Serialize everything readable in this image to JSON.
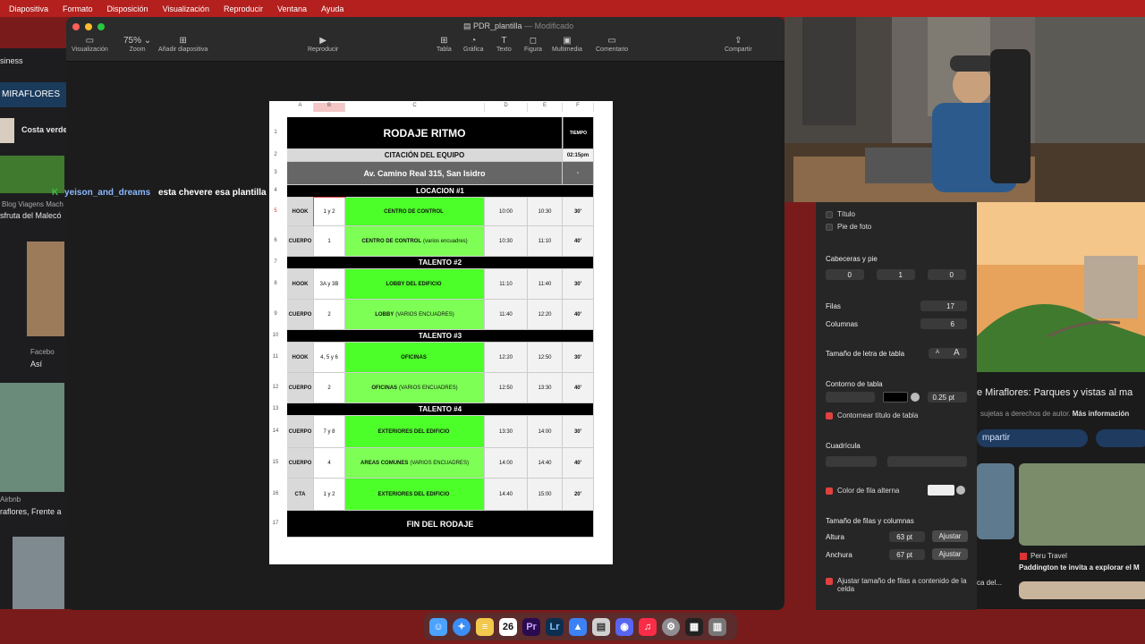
{
  "menubar": {
    "items": [
      "Diapositiva",
      "Formato",
      "Disposición",
      "Visualización",
      "Reproducir",
      "Ventana",
      "Ayuda"
    ]
  },
  "left_browser": {
    "items": [
      "siness",
      "MIRAFLORES",
      "Costa verde",
      "yeison_and_dreams",
      "esta chevere esa plantilla",
      "Blog Viagens Mach",
      "sfruta del Malecó",
      "Facebo",
      "Así",
      "Airbnb",
      "raflores, Frente a"
    ]
  },
  "keynote": {
    "title": "PDR_plantilla",
    "title_sub": "— Modificado",
    "zoom": "75%",
    "toolbar": [
      {
        "label": "Visualización",
        "icon": "sidebar-icon"
      },
      {
        "label": "Zoom",
        "icon": "zoom-icon"
      },
      {
        "label": "Añadir diapositiva",
        "icon": "plus-icon"
      },
      {
        "label": "Reproducir",
        "icon": "play-icon"
      },
      {
        "label": "Tabla",
        "icon": "table-icon"
      },
      {
        "label": "Gráfica",
        "icon": "chart-icon"
      },
      {
        "label": "Texto",
        "icon": "text-icon"
      },
      {
        "label": "Figura",
        "icon": "shape-icon"
      },
      {
        "label": "Multimedia",
        "icon": "media-icon"
      },
      {
        "label": "Comentario",
        "icon": "comment-icon"
      },
      {
        "label": "Compartir",
        "icon": "share-icon"
      }
    ]
  },
  "table": {
    "columns": [
      "A",
      "B",
      "C",
      "D",
      "E",
      "F"
    ],
    "row_numbers": [
      "1",
      "2",
      "3",
      "4",
      "5",
      "6",
      "7",
      "8",
      "9",
      "10",
      "11",
      "12",
      "13",
      "14",
      "15",
      "16",
      "17"
    ],
    "title": "RODAJE RITMO",
    "tiempo": "TIEMPO",
    "citacion": "CITACIÓN DEL EQUIPO",
    "citacion_time": "02:15pm",
    "address": "Av. Camino Real 315, San Isidro",
    "address_right": "-",
    "sections": [
      "LOCACION #1",
      "TALENTO #2",
      "TALENTO #3",
      "TALENTO #4"
    ],
    "rows": [
      {
        "a": "HOOK",
        "b": "1 y 2",
        "c": "CENTRO DE CONTROL",
        "c_sub": "",
        "d": "10:00",
        "e": "10:30",
        "f": "30'"
      },
      {
        "a": "CUERPO",
        "b": "1",
        "c": "CENTRO DE CONTROL",
        "c_sub": "(varios encuadres)",
        "d": "10:30",
        "e": "11:10",
        "f": "40'"
      },
      {
        "a": "HOOK",
        "b": "3A y 3B",
        "c": "LOBBY DEL EDIFICIO",
        "c_sub": "",
        "d": "11:10",
        "e": "11:40",
        "f": "30'"
      },
      {
        "a": "CUERPO",
        "b": "2",
        "c": "LOBBY",
        "c_sub": "(VARIOS ENCUADRES)",
        "d": "11:40",
        "e": "12:20",
        "f": "40'"
      },
      {
        "a": "HOOK",
        "b": "4, 5 y 6",
        "c": "OFICINAS",
        "c_sub": "",
        "d": "12:20",
        "e": "12:50",
        "f": "30'"
      },
      {
        "a": "CUERPO",
        "b": "2",
        "c": "OFICINAS",
        "c_sub": "(VARIOS ENCUADRES)",
        "d": "12:50",
        "e": "13:30",
        "f": "40'"
      },
      {
        "a": "CUERPO",
        "b": "7 y 8",
        "c": "EXTERIORES DEL EDIFICIO",
        "c_sub": "",
        "d": "13:30",
        "e": "14:00",
        "f": "30'"
      },
      {
        "a": "CUERPO",
        "b": "4",
        "c": "AREAS COMUNES",
        "c_sub": "(VARIOS ENCUADRES)",
        "d": "14:00",
        "e": "14:40",
        "f": "40'"
      },
      {
        "a": "CTA",
        "b": "1 y 2",
        "c": "EXTERIORES DEL EDIFICIO",
        "c_sub": "",
        "d": "14:40",
        "e": "15:00",
        "f": "20'"
      }
    ],
    "footer": "FIN DEL RODAJE"
  },
  "inspector": {
    "titulo": "Título",
    "pie": "Pie de foto",
    "cabeceras_label": "Cabeceras y pie",
    "cabeceras_values": [
      "0",
      "1",
      "0"
    ],
    "filas_label": "Filas",
    "filas": "17",
    "columnas_label": "Columnas",
    "columnas": "6",
    "tamano_letra": "Tamaño de letra de tabla",
    "font_small": "A",
    "font_big": "A",
    "contorno_label": "Contorno de tabla",
    "contorno_pt": "0.25 pt",
    "contornear": "Contornear título de tabla",
    "cuadricula": "Cuadrícula",
    "color_fila": "Color de fila alterna",
    "tamano_filas": "Tamaño de filas y columnas",
    "altura_label": "Altura",
    "altura": "63 pt",
    "anchura_label": "Anchura",
    "anchura": "67 pt",
    "ajustar": "Ajustar",
    "ajustar_contenido": "Ajustar tamaño de filas a contenido de la celda"
  },
  "right_browser": {
    "headline": "e Miraflores: Parques y vistas al ma",
    "rights": "sujetas a derechos de autor.",
    "more_info": "Más información",
    "share": "mpartir",
    "source": "Peru Travel",
    "caption": "Paddington te invita a explorar el M",
    "left_caption": "ca del..."
  },
  "dock": {
    "calendar": "26",
    "items": [
      "finder-icon",
      "safari-icon",
      "notes-icon",
      "calendar-icon",
      "premiere-icon",
      "lightroom-icon",
      "keynote-icon",
      "preview-icon",
      "discord-icon",
      "music-icon",
      "settings-icon",
      "screen-icon",
      "trash-icon"
    ]
  }
}
